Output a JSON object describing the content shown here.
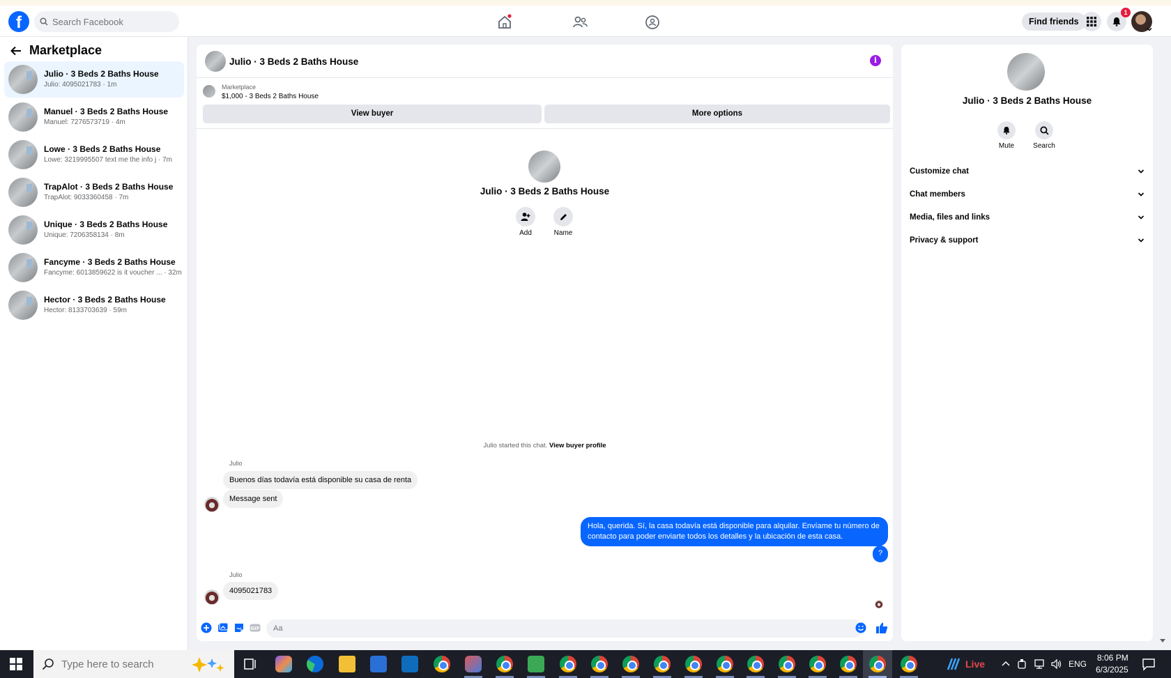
{
  "topbar": {
    "logo": "f",
    "search_placeholder": "Search Facebook",
    "find_friends": "Find friends",
    "notification_count": "1"
  },
  "sidebar": {
    "title": "Marketplace",
    "conversations": [
      {
        "name": "Julio · 3 Beds 2 Baths House",
        "preview": "Julio: 4095021783 · 1m"
      },
      {
        "name": "Manuel · 3 Beds 2 Baths House",
        "preview": "Manuel: 7276573719 · 4m"
      },
      {
        "name": "Lowe · 3 Beds 2 Baths House",
        "preview": "Lowe: 3219995507 text me the info j · 7m"
      },
      {
        "name": "TrapAlot · 3 Beds 2 Baths House",
        "preview": "TrapAlot: 9033360458 · 7m"
      },
      {
        "name": "Unique · 3 Beds 2 Baths House",
        "preview": "Unique: 7206358134 · 8m"
      },
      {
        "name": "Fancyme · 3 Beds 2 Baths House",
        "preview": "Fancyme: 6013859622 is it voucher ... · 32m"
      },
      {
        "name": "Hector · 3 Beds 2 Baths House",
        "preview": "Hector: 8133703639 · 59m"
      }
    ]
  },
  "chat": {
    "title": "Julio · 3 Beds 2 Baths House",
    "info_glyph": "i",
    "marketplace_label": "Marketplace",
    "listing": "$1,000 - 3 Beds 2 Baths House",
    "view_buyer": "View buyer",
    "more_options": "More options",
    "intro_name": "Julio · 3 Beds 2 Baths House",
    "add_label": "Add",
    "name_label": "Name",
    "started_text": "Julio started this chat.",
    "view_buyer_profile": "View buyer profile",
    "messages": {
      "sender1": "Julio",
      "msg1": "Buenos días todavía está disponible su casa de renta",
      "msg2": "Message sent",
      "reply_line1": "Hola, querida. Sí, la casa todavía está disponible para alquilar. Envíame tu número de",
      "reply_line2": "contacto para poder enviarte todos los detalles y la ubicación de esta casa.",
      "reply_q": "?",
      "sender2": "Julio",
      "msg3": "4095021783"
    },
    "composer_placeholder": "Aa"
  },
  "details": {
    "name": "Julio · 3 Beds 2 Baths House",
    "mute": "Mute",
    "search": "Search",
    "sections": [
      "Customize chat",
      "Chat members",
      "Media, files and links",
      "Privacy & support"
    ]
  },
  "taskbar": {
    "search_placeholder": "Type here to search",
    "live": "Live",
    "lang": "ENG",
    "time": "8:06 PM",
    "date": "6/3/2025"
  },
  "colors": {
    "brand": "#0866ff",
    "info": "#9b1ce6",
    "badge": "#e41e3f"
  }
}
